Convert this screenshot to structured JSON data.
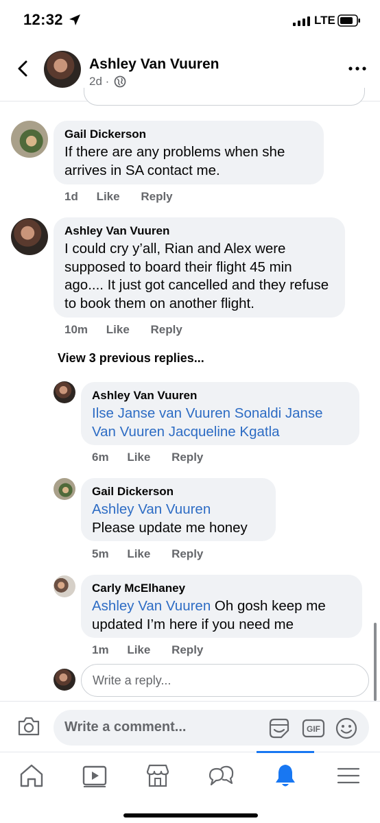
{
  "status_bar": {
    "time": "12:32",
    "network": "LTE"
  },
  "post_header": {
    "name": "Ashley Van Vuuren",
    "meta": "2d ·"
  },
  "comments": [
    {
      "author": "Gail Dickerson",
      "text": "If there are any problems when she arrives in SA contact me.",
      "time": "1d",
      "like": "Like",
      "reply": "Reply"
    },
    {
      "author": "Ashley Van Vuuren",
      "text": "I could cry y’all, Rian and Alex were supposed to board their flight 45 min ago.... It just got cancelled and they refuse to book them on another flight.",
      "time": "10m",
      "like": "Like",
      "reply": "Reply"
    }
  ],
  "view_previous": "View 3 previous replies...",
  "replies": [
    {
      "author": "Ashley Van Vuuren",
      "mention": "Ilse Janse van Vuuren Sonaldi Janse Van Vuuren Jacqueline Kgatla",
      "text": "",
      "time": "6m",
      "like": "Like",
      "reply": "Reply"
    },
    {
      "author": "Gail Dickerson",
      "mention": "Ashley Van Vuuren",
      "text": "Please update me honey",
      "time": "5m",
      "like": "Like",
      "reply": "Reply"
    },
    {
      "author": "Carly McElhaney",
      "mention": "Ashley Van Vuuren",
      "text": " Oh gosh keep me updated I’m here if you need me",
      "time": "1m",
      "like": "Like",
      "reply": "Reply"
    }
  ],
  "reply_input": {
    "placeholder": "Write a reply..."
  },
  "comment_input": {
    "placeholder": "Write a comment..."
  },
  "composer_icons": [
    "camera-icon",
    "sticker-icon",
    "gif-icon",
    "emoji-icon"
  ],
  "tabs": [
    {
      "id": "home",
      "icon": "home-icon"
    },
    {
      "id": "watch",
      "icon": "video-icon"
    },
    {
      "id": "marketplace",
      "icon": "store-icon"
    },
    {
      "id": "groups",
      "icon": "chat-bubbles-icon"
    },
    {
      "id": "notifications",
      "icon": "bell-icon",
      "active": true
    },
    {
      "id": "menu",
      "icon": "menu-icon"
    }
  ],
  "colors": {
    "accent": "#1877f2",
    "mention": "#2d6cc4",
    "bubble": "#f0f2f5",
    "secondary_text": "#65676b"
  }
}
